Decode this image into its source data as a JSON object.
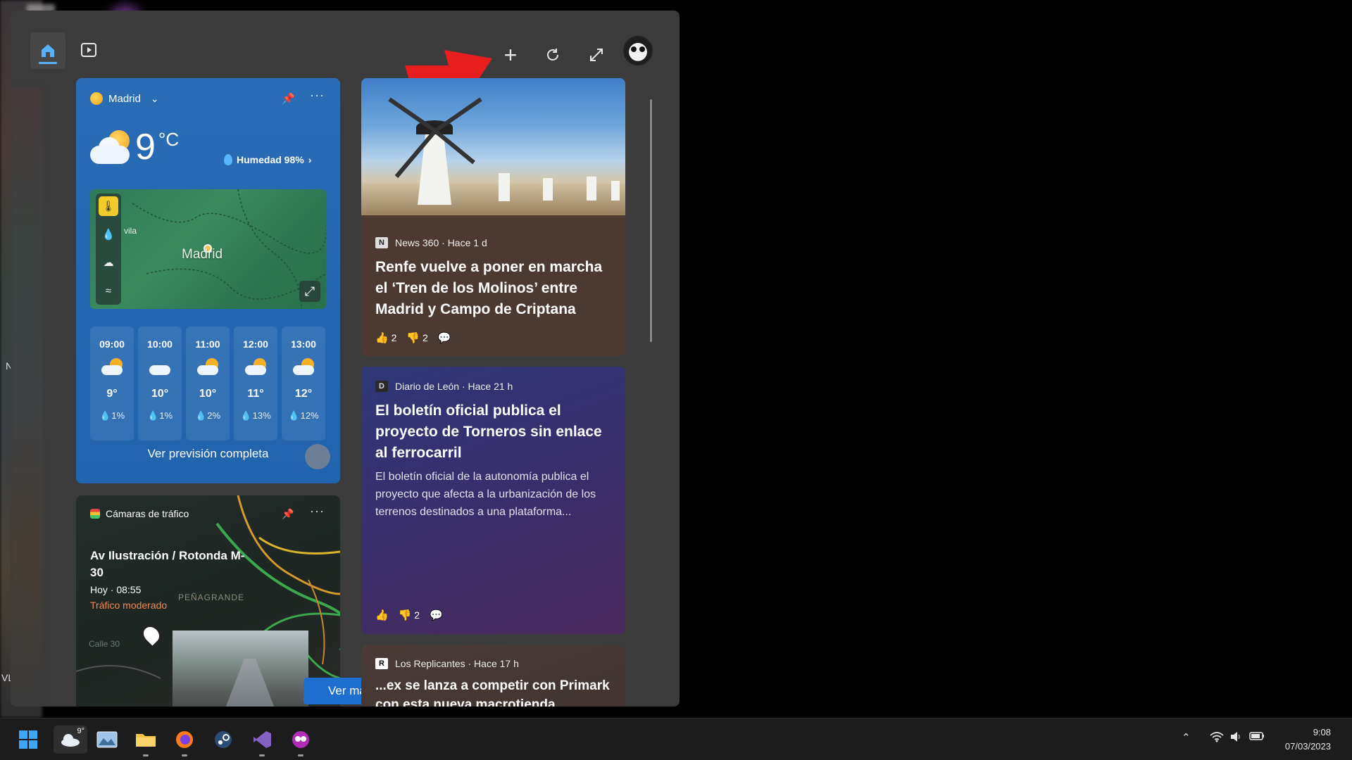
{
  "topbar": {
    "home": "home-icon",
    "video": "video-icon",
    "add_label": "+",
    "refresh": "refresh-icon",
    "expand": "expand-icon"
  },
  "weather": {
    "location": "Madrid",
    "temperature": "9",
    "unit": "°C",
    "humidity": "Humedad 98%",
    "map_city": "Madrid",
    "map_city_partial": "vila",
    "forecast_link": "Ver previsión completa",
    "hours": [
      {
        "time": "09:00",
        "temp": "9°",
        "precip": "1%",
        "sun": true
      },
      {
        "time": "10:00",
        "temp": "10°",
        "precip": "1%",
        "sun": false
      },
      {
        "time": "11:00",
        "temp": "10°",
        "precip": "2%",
        "sun": true
      },
      {
        "time": "12:00",
        "temp": "11°",
        "precip": "13%",
        "sun": true
      },
      {
        "time": "13:00",
        "temp": "12°",
        "precip": "12%",
        "sun": true
      }
    ]
  },
  "traffic": {
    "header": "Cámaras de tráfico",
    "title": "Av Ilustración / Rotonda M-30",
    "time": "Hoy · 08:55",
    "status": "Tráfico moderado",
    "map_label": "PEÑAGRANDE",
    "map_label2": "Calle 30"
  },
  "ver_mas": "Ver más",
  "news": [
    {
      "source": "News 360 · Hace 1 d",
      "headline": "Renfe vuelve a poner en marcha el ‘Tren de los Molinos’ entre Madrid y Campo de Criptana",
      "likes": "2",
      "dislikes": "2"
    },
    {
      "source": "Diario de León · Hace 21 h",
      "headline": "El boletín oficial publica el proyecto de Torneros sin enlace al ferrocarril",
      "summary": "El boletín oficial de la autonomía publica el proyecto que afecta a la urbanización de los terrenos destinados a una plataforma...",
      "dislikes": "2"
    },
    {
      "source": "Los Replicantes · Hace 17 h",
      "headline": "...ex se lanza a competir con Primark con esta nueva macrotienda"
    }
  ],
  "taskbar": {
    "weather_temp": "9°",
    "time": "9:08",
    "date": "07/03/2023"
  },
  "colors": {
    "accent": "#1f6fd0",
    "weather_bg": "#2466b0",
    "traffic_status": "#f08a50"
  }
}
